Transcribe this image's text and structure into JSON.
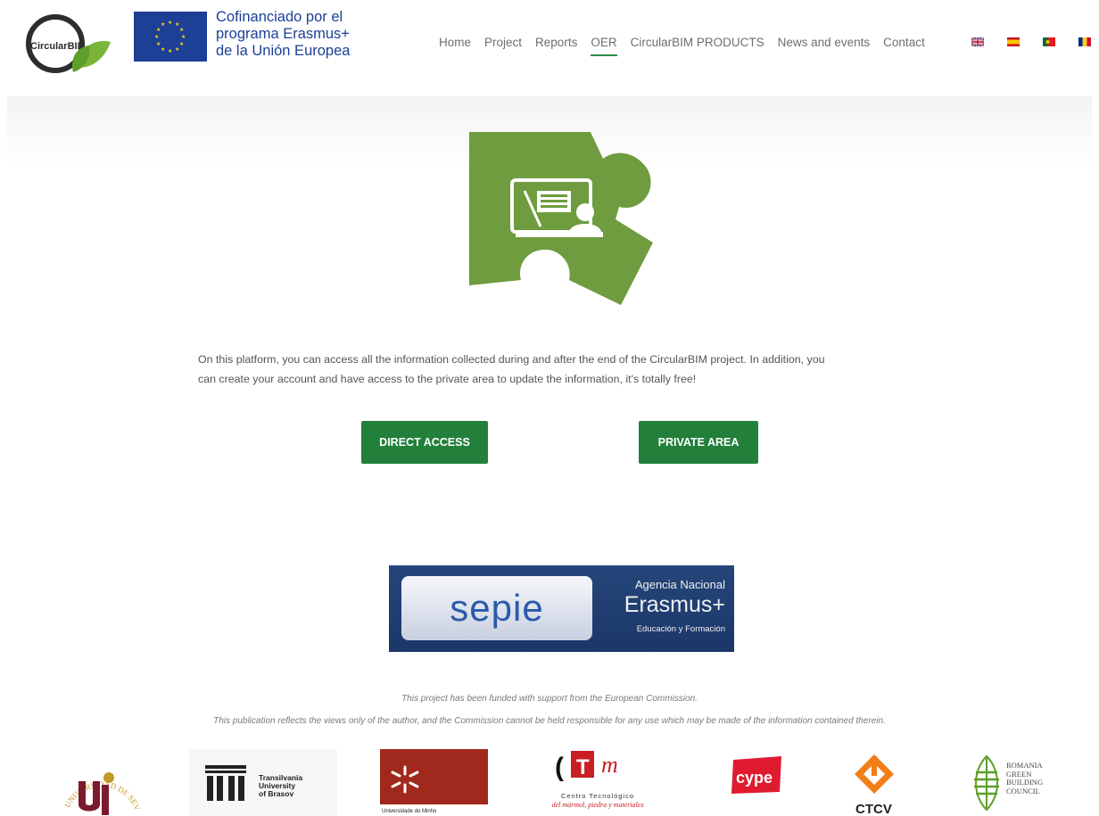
{
  "header": {
    "logo_text": "CircularBIM",
    "eu_text_line1": "Cofinanciado por el",
    "eu_text_line2": "programa Erasmus+",
    "eu_text_line3": "de la Unión Europea"
  },
  "nav": {
    "items": [
      {
        "label": "Home"
      },
      {
        "label": "Project"
      },
      {
        "label": "Reports"
      },
      {
        "label": "OER"
      },
      {
        "label": "CircularBIM PRODUCTS"
      },
      {
        "label": "News and events"
      },
      {
        "label": "Contact"
      }
    ],
    "active": "OER"
  },
  "languages": [
    "english-flag-icon",
    "spanish-flag-icon",
    "portuguese-flag-icon",
    "romanian-flag-icon"
  ],
  "main": {
    "intro_line1": "On this platform, you can access all the information collected during and after the end of the CircularBIM project. In addition, you",
    "intro_line2": "can create your account and have access to the private area to update the information, it's totally free!",
    "button_direct": "DIRECT ACCESS",
    "button_private": "PRIVATE AREA"
  },
  "sepie": {
    "logo": "sepie",
    "right_line1": "Agencia Nacional",
    "right_line2": "Erasmus+",
    "right_line3": "Educación y Formación"
  },
  "footer": {
    "disclaimer1": "This project has been funded with support from the European Commission.",
    "disclaimer2": "This publication reflects the views only of the author, and the Commission cannot be held responsible for any use which may be made of the information contained therein."
  },
  "partners": {
    "sevilla": "UNIVERSIDAD DE SEVILLA",
    "brasov_1": "Transilvania",
    "brasov_2": "University",
    "brasov_3": "of Brasov",
    "minho": "Universidade do Minho",
    "ctm_1": "Centro Tecnológico",
    "ctm_2": "del mármol, piedra y materiales",
    "cype": "cype",
    "ctcv": "CTCV",
    "rogbc_1": "ROMANIA",
    "rogbc_2": "GREEN",
    "rogbc_3": "BUILDING",
    "rogbc_4": "COUNCIL"
  },
  "colors": {
    "accent_green": "#22803b",
    "puzzle_green": "#6e9c3e",
    "eu_blue": "#1d3f95",
    "nav_text": "#6e6e6e"
  }
}
